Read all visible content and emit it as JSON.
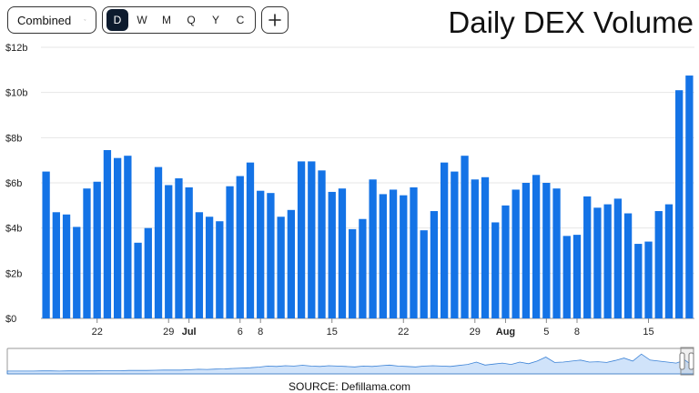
{
  "toolbar": {
    "dropdown_label": "Combined",
    "periods": [
      "D",
      "W",
      "M",
      "Q",
      "Y",
      "C"
    ],
    "active_period": "D"
  },
  "title": "Daily DEX Volume",
  "source": "SOURCE: Defillama.com",
  "colors": {
    "bar": "#1473e6",
    "active": "#0d1b2e"
  },
  "chart_data": {
    "type": "bar",
    "title": "Daily DEX Volume",
    "unit": "$ billions",
    "ylim": [
      0,
      12
    ],
    "yticks": [
      "$0",
      "$2b",
      "$4b",
      "$6b",
      "$8b",
      "$10b",
      "$12b"
    ],
    "xticks": [
      {
        "label": "22",
        "index": 5,
        "bold": false
      },
      {
        "label": "29",
        "index": 12,
        "bold": false
      },
      {
        "label": "Jul",
        "index": 14,
        "bold": true
      },
      {
        "label": "6",
        "index": 19,
        "bold": false
      },
      {
        "label": "8",
        "index": 21,
        "bold": false
      },
      {
        "label": "15",
        "index": 28,
        "bold": false
      },
      {
        "label": "22",
        "index": 35,
        "bold": false
      },
      {
        "label": "29",
        "index": 42,
        "bold": false
      },
      {
        "label": "Aug",
        "index": 45,
        "bold": true
      },
      {
        "label": "5",
        "index": 49,
        "bold": false
      },
      {
        "label": "8",
        "index": 52,
        "bold": false
      },
      {
        "label": "15",
        "index": 59,
        "bold": false
      }
    ],
    "values": [
      6.5,
      4.7,
      4.6,
      4.05,
      5.75,
      6.05,
      7.45,
      7.1,
      7.2,
      3.35,
      4.0,
      6.7,
      5.9,
      6.2,
      5.8,
      4.7,
      4.5,
      4.3,
      5.85,
      6.3,
      6.9,
      5.65,
      5.55,
      4.5,
      4.8,
      6.95,
      6.95,
      6.55,
      5.6,
      5.75,
      3.95,
      4.4,
      6.15,
      5.5,
      5.7,
      5.45,
      5.8,
      3.9,
      4.75,
      6.9,
      6.5,
      7.2,
      6.15,
      6.25,
      4.25,
      5.0,
      5.7,
      6.0,
      6.35,
      6.0,
      5.75,
      3.65,
      3.7,
      5.4,
      4.9,
      5.05,
      5.3,
      4.65,
      3.3,
      3.4,
      4.75,
      5.05,
      10.1,
      10.75
    ],
    "grid": true,
    "legend": "none",
    "overview": [
      0.05,
      0.05,
      0.05,
      0.05,
      0.06,
      0.06,
      0.05,
      0.06,
      0.06,
      0.06,
      0.06,
      0.07,
      0.07,
      0.07,
      0.08,
      0.08,
      0.08,
      0.09,
      0.1,
      0.1,
      0.1,
      0.12,
      0.14,
      0.13,
      0.15,
      0.16,
      0.18,
      0.2,
      0.22,
      0.25,
      0.3,
      0.28,
      0.32,
      0.3,
      0.34,
      0.3,
      0.28,
      0.32,
      0.3,
      0.28,
      0.26,
      0.3,
      0.28,
      0.32,
      0.35,
      0.3,
      0.28,
      0.26,
      0.3,
      0.32,
      0.3,
      0.28,
      0.33,
      0.38,
      0.5,
      0.35,
      0.4,
      0.45,
      0.38,
      0.5,
      0.42,
      0.55,
      0.75,
      0.48,
      0.5,
      0.55,
      0.6,
      0.5,
      0.52,
      0.48,
      0.58,
      0.7,
      0.55,
      0.9,
      0.6,
      0.55,
      0.5,
      0.45,
      0.6,
      0.3
    ]
  }
}
